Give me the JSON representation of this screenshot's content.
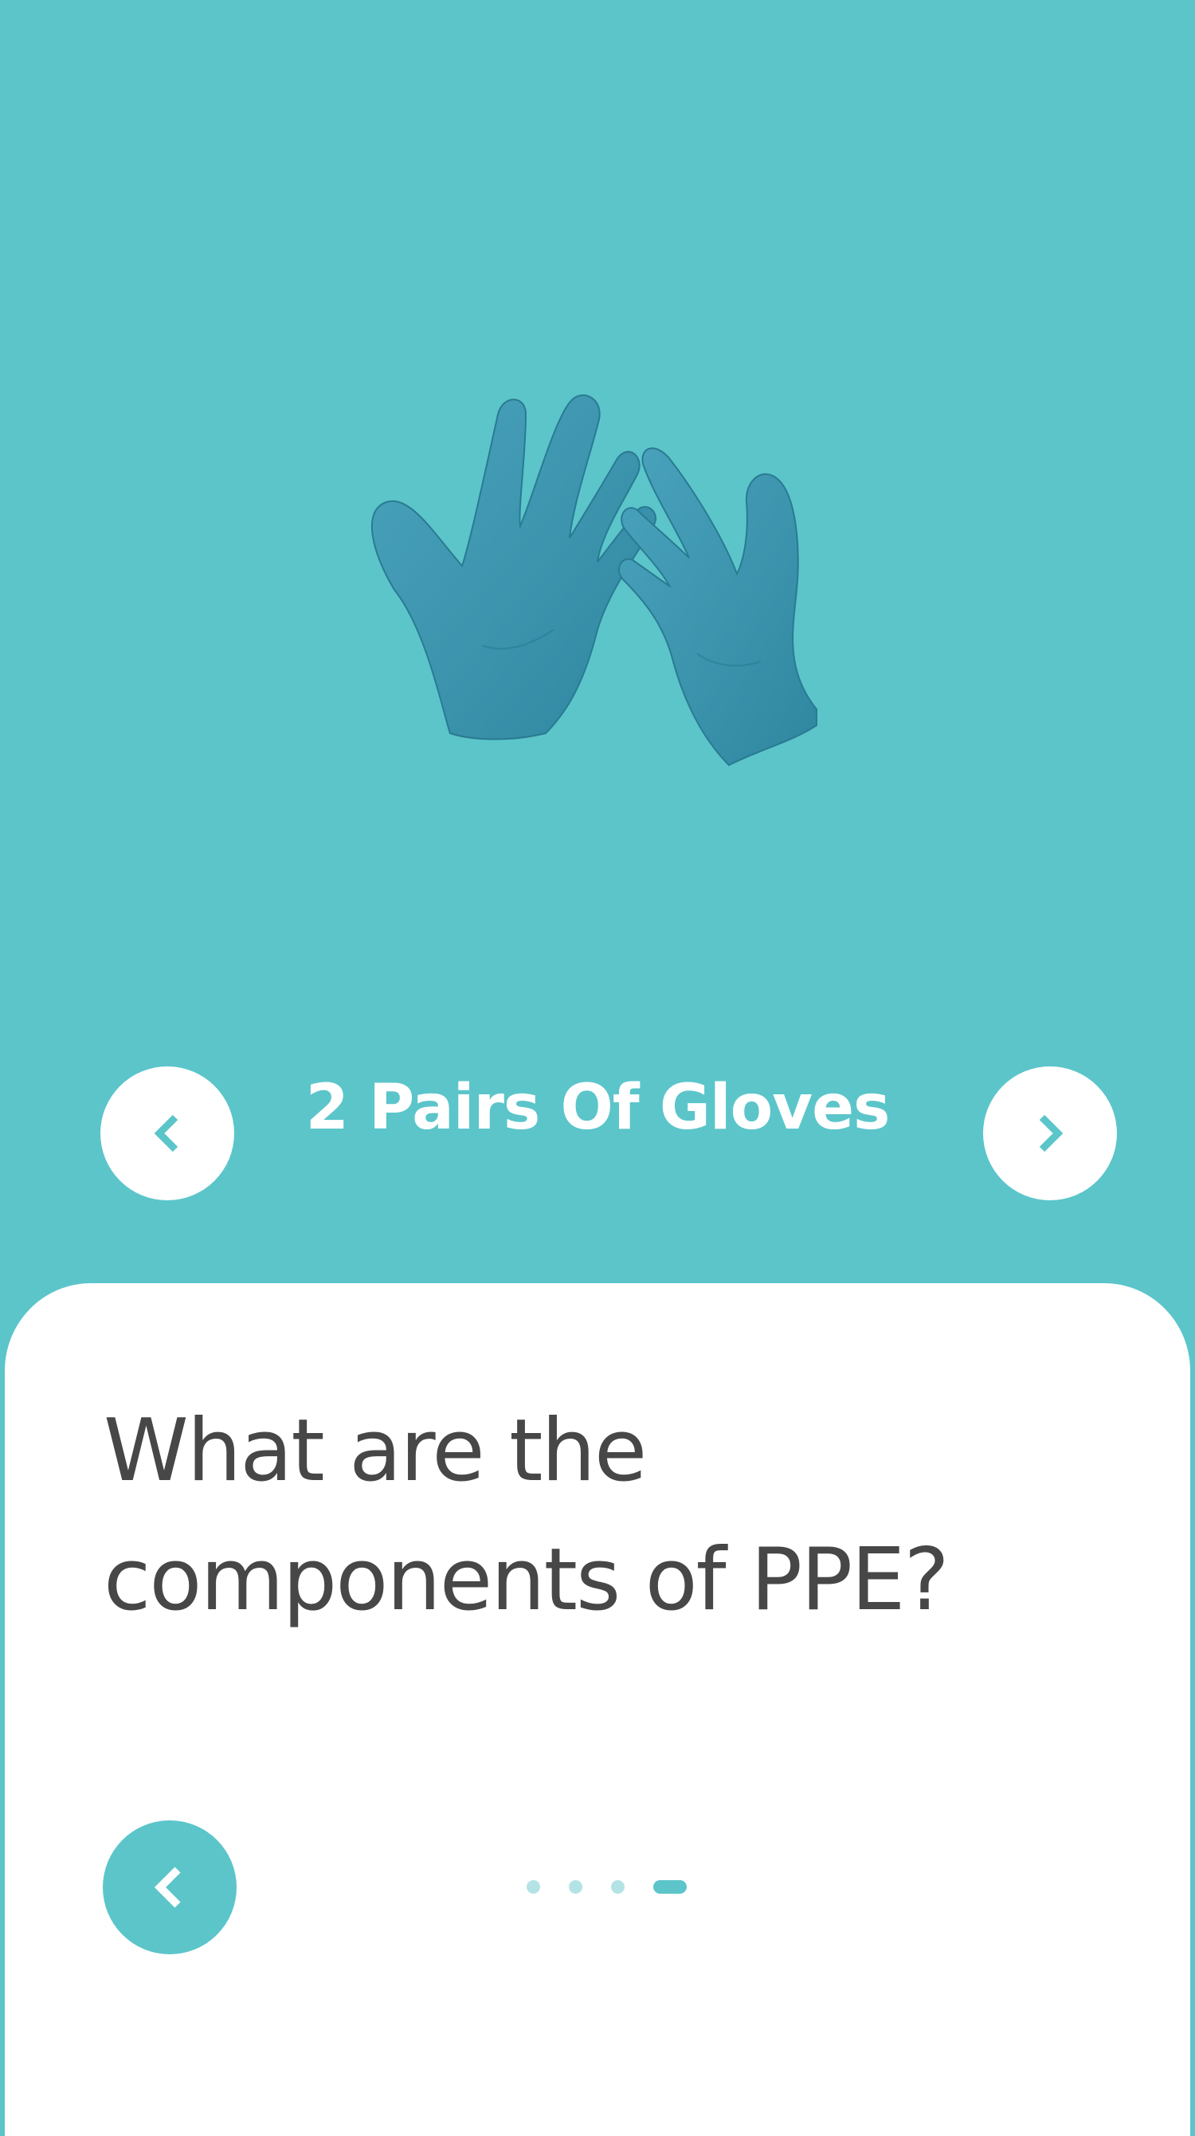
{
  "hero": {
    "image_icon": "gloved-hands-icon",
    "glove_color": "#3a93ad",
    "background_color": "#5bc5ca"
  },
  "nav": {
    "item_title": "2 Pairs Of Gloves",
    "prev_icon": "chevron-left-icon",
    "next_icon": "chevron-right-icon"
  },
  "card": {
    "question": "What are the components of PPE?",
    "back_icon": "chevron-left-icon"
  },
  "pagination": {
    "total_pages": 4,
    "current_page": 4
  },
  "colors": {
    "accent": "#5bc5ca",
    "text": "#474747",
    "inactive_dot": "#b4e3e6",
    "white": "#ffffff"
  }
}
